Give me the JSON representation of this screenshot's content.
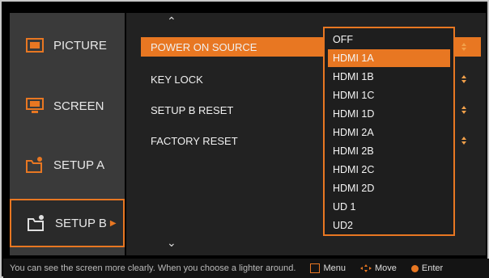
{
  "sidebar": {
    "items": [
      {
        "label": "PICTURE",
        "icon": "picture-icon"
      },
      {
        "label": "SCREEN",
        "icon": "screen-icon"
      },
      {
        "label": "SETUP A",
        "icon": "setup-a-icon"
      },
      {
        "label": "SETUP B",
        "icon": "setup-b-icon",
        "active": true
      }
    ]
  },
  "menu": {
    "items": [
      {
        "label": "POWER ON SOURCE",
        "selected": true
      },
      {
        "label": "KEY LOCK"
      },
      {
        "label": "SETUP B RESET"
      },
      {
        "label": "FACTORY RESET"
      }
    ]
  },
  "dropdown": {
    "options": [
      "OFF",
      "HDMI 1A",
      "HDMI 1B",
      "HDMI 1C",
      "HDMI 1D",
      "HDMI 2A",
      "HDMI 2B",
      "HDMI 2C",
      "HDMI 2D",
      "UD 1",
      "UD2"
    ],
    "selected": "HDMI 1A"
  },
  "status": {
    "help": "You can see the screen more clearly.  When you choose a lighter around.",
    "menu": "Menu",
    "move": "Move",
    "enter": "Enter"
  },
  "colors": {
    "accent": "#e87722",
    "panel": "#3a3a3a",
    "background": "#222222"
  }
}
